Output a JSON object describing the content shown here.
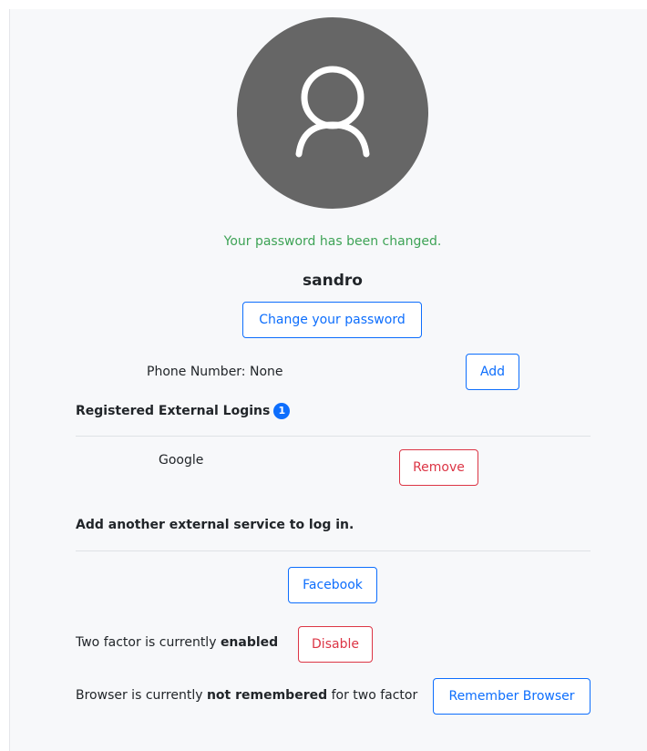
{
  "profile": {
    "avatar_icon": "user-icon",
    "status_message": "Your password has been changed.",
    "username": "sandro",
    "change_password_label": "Change your password"
  },
  "phone": {
    "label": "Phone Number: None",
    "add_label": "Add"
  },
  "external_logins": {
    "title": "Registered External Logins",
    "count": "1",
    "items": [
      {
        "provider": "Google",
        "remove_label": "Remove"
      }
    ]
  },
  "add_service": {
    "title": "Add another external service to log in.",
    "providers": [
      {
        "label": "Facebook"
      }
    ]
  },
  "two_factor": {
    "prefix": "Two factor is currently ",
    "state": "enabled",
    "disable_label": "Disable"
  },
  "browser": {
    "prefix": "Browser is currently ",
    "state": "not remembered",
    "suffix": " for two factor",
    "remember_label": "Remember Browser"
  },
  "colors": {
    "primary": "#0d6efd",
    "danger": "#dc3545",
    "success": "#3ea356",
    "avatar_bg": "#666666"
  }
}
